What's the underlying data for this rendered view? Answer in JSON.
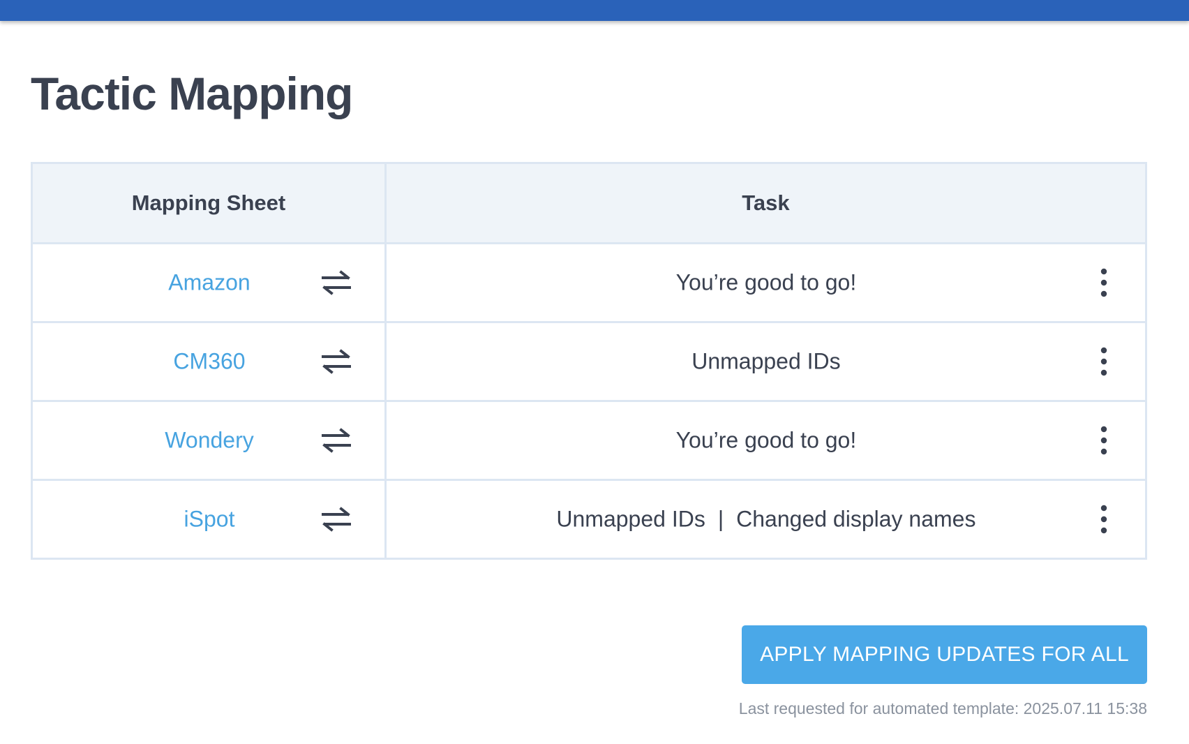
{
  "page": {
    "title": "Tactic Mapping"
  },
  "table": {
    "headers": {
      "sheet": "Mapping Sheet",
      "task": "Task"
    },
    "rows": [
      {
        "sheet": "Amazon",
        "tasks": [
          "You’re good to go!"
        ]
      },
      {
        "sheet": "CM360",
        "tasks": [
          "Unmapped IDs"
        ]
      },
      {
        "sheet": "Wondery",
        "tasks": [
          "You’re good to go!"
        ]
      },
      {
        "sheet": "iSpot",
        "tasks": [
          "Unmapped IDs",
          "Changed display names"
        ],
        "separator": "|"
      }
    ],
    "row_icons": {
      "sync": "swap-arrows-icon",
      "menu": "more-vertical-icon"
    }
  },
  "actions": {
    "apply_all_label": "APPLY MAPPING UPDATES FOR ALL"
  },
  "footer": {
    "last_requested": "Last requested for automated template: 2025.07.11 15:38"
  },
  "colors": {
    "topbar": "#2a62b9",
    "link": "#47a3e0",
    "button": "#4aa8e8",
    "header_bg": "#eff4f9",
    "border": "#dce6f2",
    "text": "#3a4150",
    "muted": "#8a929e"
  }
}
